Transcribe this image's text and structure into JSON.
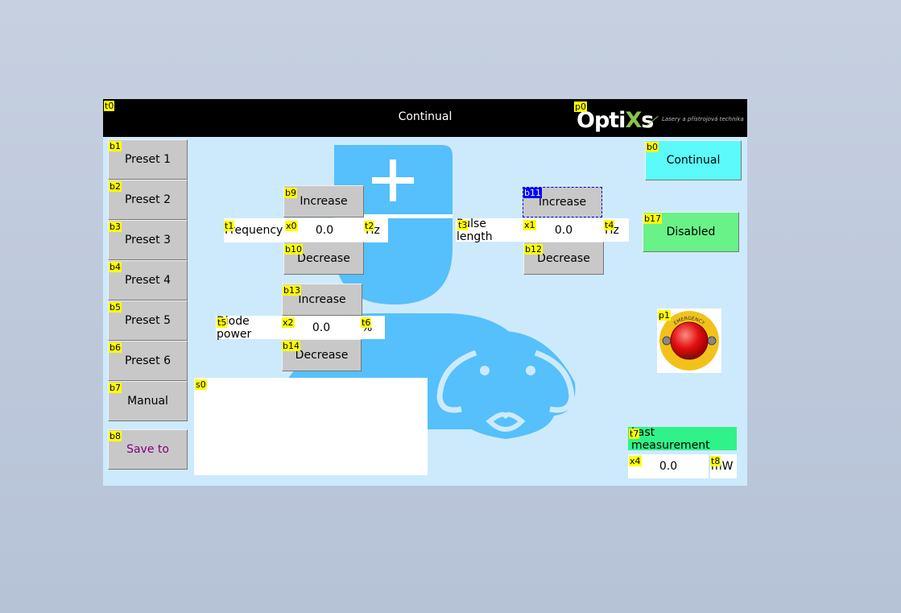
{
  "header": {
    "title": "Continual",
    "logo_word_a": "Opti",
    "logo_word_x": "X",
    "logo_word_b": "s",
    "logo_tagline": "Lasery a přístrojová technika"
  },
  "tags": {
    "t0": "t0",
    "p0": "p0",
    "b0": "b0",
    "b1": "b1",
    "b2": "b2",
    "b3": "b3",
    "b4": "b4",
    "b5": "b5",
    "b6": "b6",
    "b7": "b7",
    "b8": "b8",
    "b9": "b9",
    "b10": "b10",
    "b11": "b11",
    "b12": "b12",
    "b13": "b13",
    "b14": "b14",
    "b17": "b17",
    "t1": "t1",
    "t2": "t2",
    "t3": "t3",
    "t4": "t4",
    "t5": "t5",
    "t6": "t6",
    "t7": "t7",
    "t8": "t8",
    "x0": "x0",
    "x1": "x1",
    "x2": "x2",
    "x4": "x4",
    "p1": "p1",
    "s0": "s0"
  },
  "presets": [
    "Preset 1",
    "Preset 2",
    "Preset 3",
    "Preset 4",
    "Preset 5",
    "Preset 6"
  ],
  "manual_label": "Manual",
  "save_label": "Save to",
  "mode_button": "Continual",
  "status_button": "Disabled",
  "frequency": {
    "label": "Frequency",
    "value": "0.0",
    "unit": "Hz",
    "increase": "Increase",
    "decrease": "Decrease"
  },
  "pulse_length": {
    "label": "Pulse length",
    "value": "0.0",
    "unit": "Hz",
    "increase": "Increase",
    "decrease": "Decrease"
  },
  "diode_power": {
    "label": "Diode power",
    "value": "0.0",
    "unit": "%",
    "increase": "Increase",
    "decrease": "Decrease"
  },
  "measurement": {
    "label": "Last measurement",
    "value": "0.0",
    "unit": "mW"
  },
  "estop": {
    "top_text": "EMERGENCY",
    "bottom_text": "STOP"
  },
  "colors": {
    "panel_bg": "#cdeafc",
    "watermark": "#55c0fb",
    "mode_button": "#5cfafa",
    "status_button": "#68f287",
    "measurement_label": "#2ff389",
    "save_text": "#800080"
  }
}
